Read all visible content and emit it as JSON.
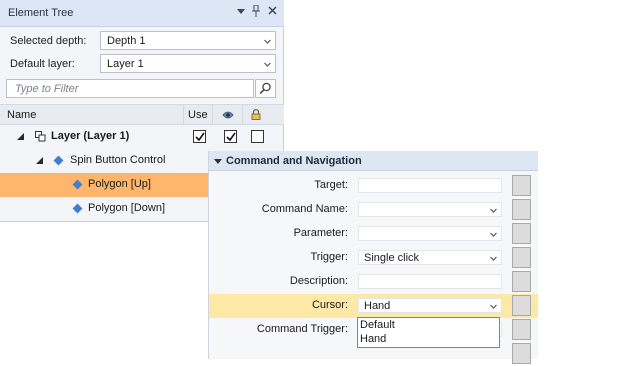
{
  "tree_panel": {
    "title": "Element Tree",
    "title_buttons": [
      "dropdown",
      "pin",
      "close"
    ],
    "selected_depth_label": "Selected depth:",
    "selected_depth_value": "Depth 1",
    "default_layer_label": "Default layer:",
    "default_layer_value": "Layer 1",
    "filter_placeholder": "Type to Filter",
    "columns": {
      "name": "Name",
      "use": "Use",
      "visible_icon": "eye-icon",
      "lock_icon": "lock-icon"
    },
    "rows": [
      {
        "label": "Layer (Layer 1)",
        "bold": true,
        "use": true,
        "visible": true,
        "locked": false
      },
      {
        "label": "Spin Button Control",
        "bold": false
      },
      {
        "label": "Polygon [Up]",
        "bold": false,
        "selected": true
      },
      {
        "label": "Polygon [Down]",
        "bold": false
      }
    ]
  },
  "command_panel": {
    "title": "Command and Navigation",
    "rows": [
      {
        "label": "Target:",
        "value": "",
        "dropdown": false
      },
      {
        "label": "Command Name:",
        "value": "",
        "dropdown": true
      },
      {
        "label": "Parameter:",
        "value": "",
        "dropdown": true
      },
      {
        "label": "Trigger:",
        "value": "Single click",
        "dropdown": true
      },
      {
        "label": "Description:",
        "value": "",
        "dropdown": false
      },
      {
        "label": "Cursor:",
        "value": "Hand",
        "dropdown": true,
        "highlighted": true
      },
      {
        "label": "Command Trigger:",
        "value": "",
        "dropdown": false
      }
    ],
    "cursor_options": [
      "Default",
      "Hand"
    ]
  },
  "colors": {
    "selection": "#fdb66b",
    "highlight_row": "#fde8a6",
    "title_bar": "#dce6f4",
    "node_icon": "#3f7ed0"
  }
}
